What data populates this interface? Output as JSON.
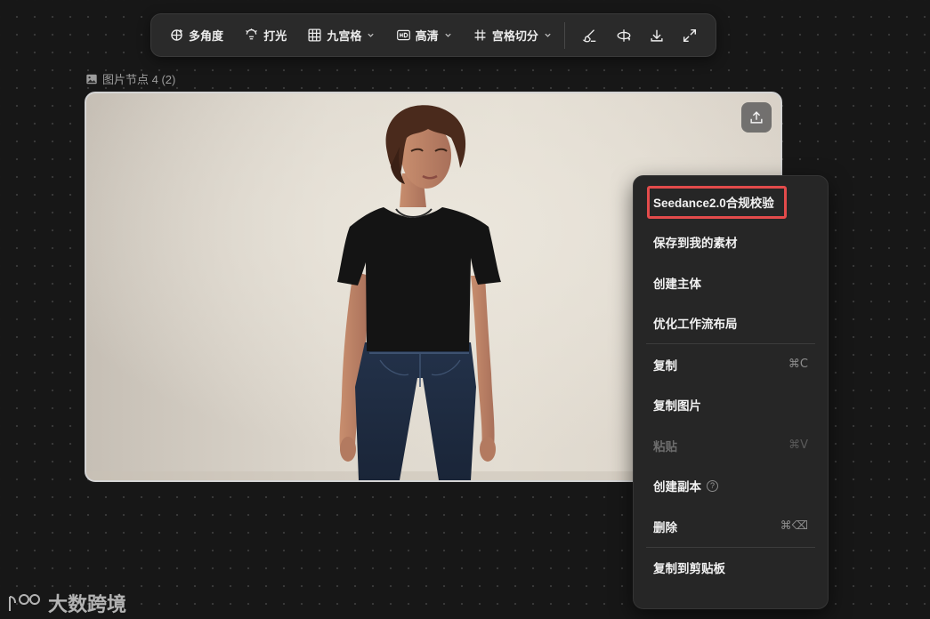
{
  "toolbar": {
    "multi_angle": "多角度",
    "lighting": "打光",
    "nine_grid": "九宫格",
    "hd": "高清",
    "grid_split": "宫格切分",
    "tools": [
      "brush-icon",
      "rotate-icon",
      "download-icon",
      "fullscreen-icon"
    ]
  },
  "node": {
    "label": "图片节点 4 (2)"
  },
  "context_menu": {
    "items": [
      {
        "label": "Seedance2.0合规校验",
        "shortcut": "",
        "disabled": false
      },
      {
        "label": "保存到我的素材",
        "shortcut": "",
        "disabled": false
      },
      {
        "label": "创建主体",
        "shortcut": "",
        "disabled": false
      },
      {
        "label": "优化工作流布局",
        "shortcut": "",
        "disabled": false
      },
      {
        "label": "复制",
        "shortcut": "⌘C",
        "disabled": false
      },
      {
        "label": "复制图片",
        "shortcut": "",
        "disabled": false
      },
      {
        "label": "粘贴",
        "shortcut": "⌘V",
        "disabled": true
      },
      {
        "label": "创建副本",
        "shortcut": "",
        "disabled": false
      },
      {
        "label": "删除",
        "shortcut": "⌘⌫",
        "disabled": false
      },
      {
        "label": "复制到剪贴板",
        "shortcut": "",
        "disabled": false
      }
    ]
  },
  "watermark": {
    "text": "大数跨境"
  },
  "colors": {
    "canvas_bg": "#171717",
    "toolbar_bg": "#2a2a2a",
    "menu_bg": "#262626",
    "highlight": "#e34b4b"
  }
}
